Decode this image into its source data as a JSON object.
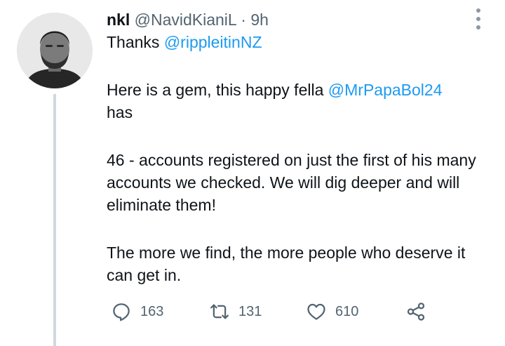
{
  "tweet": {
    "display_name": "nkl",
    "handle": "@NavidKianiL",
    "separator": "·",
    "time": "9h",
    "thanks_prefix": "Thanks ",
    "thanks_mention": "@rippleitinNZ",
    "line2_prefix": "Here is a gem, this happy fella ",
    "line2_mention": "@MrPapaBol24",
    "line2_suffix": "has",
    "para2": "46 - accounts registered on just the first of his many accounts we checked. We will dig deeper and will eliminate them!",
    "para3": "The more we find, the more people who deserve it can get in."
  },
  "actions": {
    "replies": "163",
    "retweets": "131",
    "likes": "610"
  },
  "icons": {
    "reply": "reply-icon",
    "retweet": "retweet-icon",
    "like": "heart-icon",
    "share": "share-icon",
    "more": "more-vertical-icon"
  },
  "colors": {
    "link": "#1d9bf0",
    "secondary_text": "#536471",
    "thread_line": "#cfd9de"
  }
}
